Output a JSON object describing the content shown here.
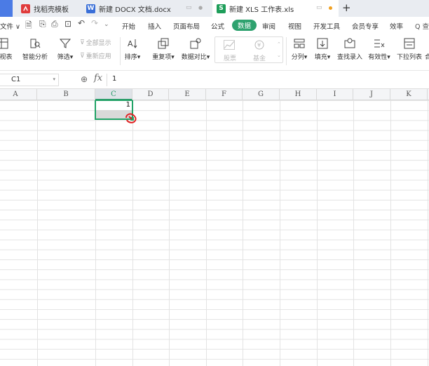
{
  "tabs": [
    {
      "label": "找稻壳模板",
      "icon": "wps-logo-icon"
    },
    {
      "label": "新建 DOCX 文档.docx",
      "icon": "word-doc-icon",
      "icon_text": "W"
    },
    {
      "label": "新建 XLS 工作表.xls",
      "icon": "spreadsheet-icon",
      "icon_text": "S",
      "active": true
    }
  ],
  "new_tab_label": "+",
  "menu": {
    "file": "文件",
    "home": "开始",
    "insert": "插入",
    "page_layout": "页面布局",
    "formula": "公式",
    "data": "数据",
    "review": "审阅",
    "view": "视图",
    "dev_tools": "开发工具",
    "member": "会员专享",
    "efficiency": "效率",
    "search": "Q 查"
  },
  "toolbar": {
    "pivot": "据视表",
    "smart_analysis": "智能分析",
    "filter": "筛选",
    "show_all": "全部显示",
    "reapply": "重新应用",
    "sort": "排序",
    "duplicates": "重复项",
    "compare": "数据对比",
    "stock": "股票",
    "fund": "基金",
    "split": "分列",
    "fill": "填充",
    "lookup": "查找录入",
    "validity": "有效性",
    "dropdown": "下拉列表",
    "more": "合"
  },
  "formula_bar": {
    "cell_ref": "C1",
    "fx": "fx",
    "value": "1"
  },
  "columns": [
    "A",
    "B",
    "C",
    "D",
    "E",
    "F",
    "G",
    "H",
    "I",
    "J",
    "K"
  ],
  "selected_column": "C",
  "cells": {
    "C1": "1"
  },
  "colors": {
    "accent": "#2ea26f",
    "selection": "#21a366",
    "tab_bar": "#e9ecf1"
  }
}
